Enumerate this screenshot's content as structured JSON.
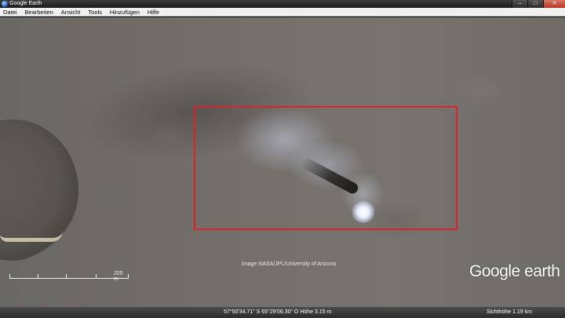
{
  "window": {
    "title": "Google Earth",
    "controls": {
      "minimize": "–",
      "maximize": "□",
      "close": "✕"
    }
  },
  "menu": {
    "items": [
      "Datei",
      "Bearbeiten",
      "Ansicht",
      "Tools",
      "Hinzufügen",
      "Hilfe"
    ]
  },
  "map": {
    "attribution": "Image NASA/JPL/University of Arizona",
    "scale_label": "205 m",
    "logo": {
      "google": "Google",
      "earth": "earth"
    },
    "highlight_color": "#e0202a"
  },
  "status": {
    "coords": "57°50'34.71\" S  65°29'06.30\" O  Höhe  3.15 m",
    "eye_altitude": "Sichthöhe    1.19 km"
  }
}
